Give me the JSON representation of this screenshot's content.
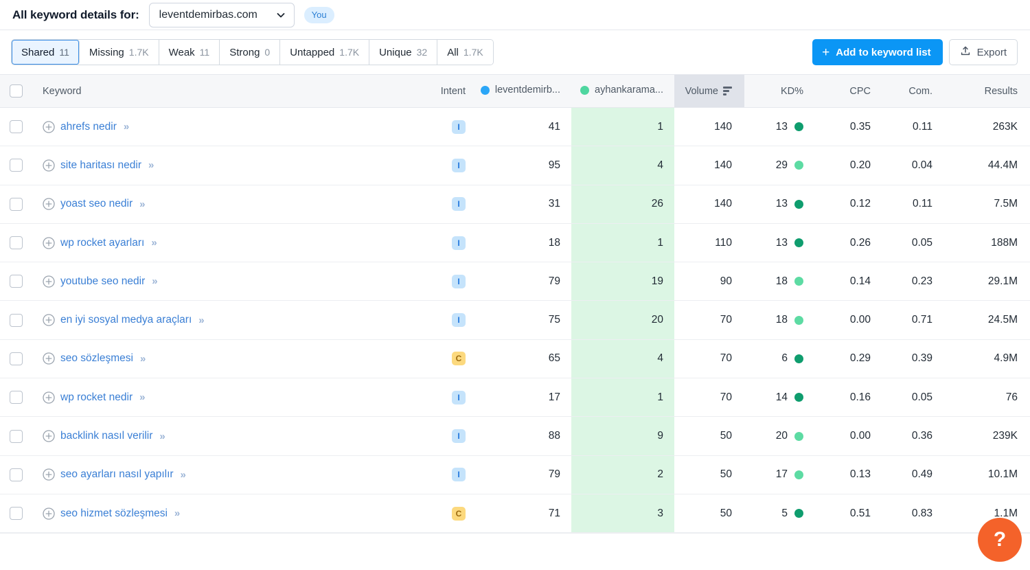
{
  "header": {
    "title": "All keyword details for:",
    "domain_selected": "leventdemirbas.com",
    "chevron_icon": "chevron-down-icon",
    "you_label": "You"
  },
  "toolbar": {
    "tabs": [
      {
        "label": "Shared",
        "count": "11",
        "active": true
      },
      {
        "label": "Missing",
        "count": "1.7K",
        "active": false
      },
      {
        "label": "Weak",
        "count": "11",
        "active": false
      },
      {
        "label": "Strong",
        "count": "0",
        "active": false
      },
      {
        "label": "Untapped",
        "count": "1.7K",
        "active": false
      },
      {
        "label": "Unique",
        "count": "32",
        "active": false
      },
      {
        "label": "All",
        "count": "1.7K",
        "active": false
      }
    ],
    "add_to_list_label": "Add to keyword list",
    "add_icon": "plus-icon",
    "export_label": "Export",
    "export_icon": "upload-icon"
  },
  "table": {
    "columns": {
      "keyword": "Keyword",
      "intent": "Intent",
      "domain1": "leventdemirb...",
      "domain2": "ayhankarama...",
      "volume": "Volume",
      "kd": "KD%",
      "cpc": "CPC",
      "com": "Com.",
      "results": "Results"
    },
    "sorted_column": "volume",
    "sort_icon": "sort-descending-icon",
    "domain1_dot_color": "#2ba6f7",
    "domain2_dot_color": "#4fd6a0",
    "highlight_color": "#dcf6e4",
    "rows": [
      {
        "keyword": "ahrefs nedir",
        "intent": "I",
        "d1": "41",
        "d2": "1",
        "volume": "140",
        "kd": "13",
        "kd_color": "#0f9d6e",
        "cpc": "0.35",
        "com": "0.11",
        "results": "263K"
      },
      {
        "keyword": "site haritası nedir",
        "intent": "I",
        "d1": "95",
        "d2": "4",
        "volume": "140",
        "kd": "29",
        "kd_color": "#5ddba3",
        "cpc": "0.20",
        "com": "0.04",
        "results": "44.4M"
      },
      {
        "keyword": "yoast seo nedir",
        "intent": "I",
        "d1": "31",
        "d2": "26",
        "volume": "140",
        "kd": "13",
        "kd_color": "#0f9d6e",
        "cpc": "0.12",
        "com": "0.11",
        "results": "7.5M"
      },
      {
        "keyword": "wp rocket ayarları",
        "intent": "I",
        "d1": "18",
        "d2": "1",
        "volume": "110",
        "kd": "13",
        "kd_color": "#0f9d6e",
        "cpc": "0.26",
        "com": "0.05",
        "results": "188M"
      },
      {
        "keyword": "youtube seo nedir",
        "intent": "I",
        "d1": "79",
        "d2": "19",
        "volume": "90",
        "kd": "18",
        "kd_color": "#5ddba3",
        "cpc": "0.14",
        "com": "0.23",
        "results": "29.1M"
      },
      {
        "keyword": "en iyi sosyal medya araçları",
        "intent": "I",
        "d1": "75",
        "d2": "20",
        "volume": "70",
        "kd": "18",
        "kd_color": "#5ddba3",
        "cpc": "0.00",
        "com": "0.71",
        "results": "24.5M"
      },
      {
        "keyword": "seo sözleşmesi",
        "intent": "C",
        "d1": "65",
        "d2": "4",
        "volume": "70",
        "kd": "6",
        "kd_color": "#0f9d6e",
        "cpc": "0.29",
        "com": "0.39",
        "results": "4.9M"
      },
      {
        "keyword": "wp rocket nedir",
        "intent": "I",
        "d1": "17",
        "d2": "1",
        "volume": "70",
        "kd": "14",
        "kd_color": "#0f9d6e",
        "cpc": "0.16",
        "com": "0.05",
        "results": "76"
      },
      {
        "keyword": "backlink nasıl verilir",
        "intent": "I",
        "d1": "88",
        "d2": "9",
        "volume": "50",
        "kd": "20",
        "kd_color": "#5ddba3",
        "cpc": "0.00",
        "com": "0.36",
        "results": "239K"
      },
      {
        "keyword": "seo ayarları nasıl yapılır",
        "intent": "I",
        "d1": "79",
        "d2": "2",
        "volume": "50",
        "kd": "17",
        "kd_color": "#5ddba3",
        "cpc": "0.13",
        "com": "0.49",
        "results": "10.1M"
      },
      {
        "keyword": "seo hizmet sözleşmesi",
        "intent": "C",
        "d1": "71",
        "d2": "3",
        "volume": "50",
        "kd": "5",
        "kd_color": "#0f9d6e",
        "cpc": "0.51",
        "com": "0.83",
        "results": "1.1M"
      }
    ],
    "row_expand_icon": "plus-circle-icon",
    "row_detail_icon": "double-chevron-right-icon"
  },
  "help": {
    "label": "?",
    "icon": "question-mark-icon",
    "color": "#f4622a"
  }
}
